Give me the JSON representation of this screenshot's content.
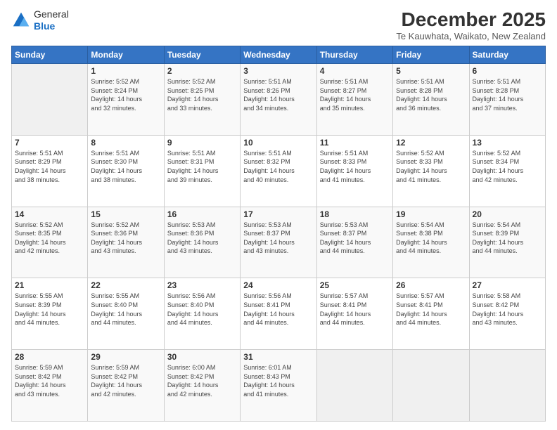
{
  "header": {
    "logo_general": "General",
    "logo_blue": "Blue",
    "month": "December 2025",
    "location": "Te Kauwhata, Waikato, New Zealand"
  },
  "weekdays": [
    "Sunday",
    "Monday",
    "Tuesday",
    "Wednesday",
    "Thursday",
    "Friday",
    "Saturday"
  ],
  "weeks": [
    [
      {
        "day": "",
        "info": ""
      },
      {
        "day": "1",
        "info": "Sunrise: 5:52 AM\nSunset: 8:24 PM\nDaylight: 14 hours\nand 32 minutes."
      },
      {
        "day": "2",
        "info": "Sunrise: 5:52 AM\nSunset: 8:25 PM\nDaylight: 14 hours\nand 33 minutes."
      },
      {
        "day": "3",
        "info": "Sunrise: 5:51 AM\nSunset: 8:26 PM\nDaylight: 14 hours\nand 34 minutes."
      },
      {
        "day": "4",
        "info": "Sunrise: 5:51 AM\nSunset: 8:27 PM\nDaylight: 14 hours\nand 35 minutes."
      },
      {
        "day": "5",
        "info": "Sunrise: 5:51 AM\nSunset: 8:28 PM\nDaylight: 14 hours\nand 36 minutes."
      },
      {
        "day": "6",
        "info": "Sunrise: 5:51 AM\nSunset: 8:28 PM\nDaylight: 14 hours\nand 37 minutes."
      }
    ],
    [
      {
        "day": "7",
        "info": "Sunrise: 5:51 AM\nSunset: 8:29 PM\nDaylight: 14 hours\nand 38 minutes."
      },
      {
        "day": "8",
        "info": "Sunrise: 5:51 AM\nSunset: 8:30 PM\nDaylight: 14 hours\nand 38 minutes."
      },
      {
        "day": "9",
        "info": "Sunrise: 5:51 AM\nSunset: 8:31 PM\nDaylight: 14 hours\nand 39 minutes."
      },
      {
        "day": "10",
        "info": "Sunrise: 5:51 AM\nSunset: 8:32 PM\nDaylight: 14 hours\nand 40 minutes."
      },
      {
        "day": "11",
        "info": "Sunrise: 5:51 AM\nSunset: 8:33 PM\nDaylight: 14 hours\nand 41 minutes."
      },
      {
        "day": "12",
        "info": "Sunrise: 5:52 AM\nSunset: 8:33 PM\nDaylight: 14 hours\nand 41 minutes."
      },
      {
        "day": "13",
        "info": "Sunrise: 5:52 AM\nSunset: 8:34 PM\nDaylight: 14 hours\nand 42 minutes."
      }
    ],
    [
      {
        "day": "14",
        "info": "Sunrise: 5:52 AM\nSunset: 8:35 PM\nDaylight: 14 hours\nand 42 minutes."
      },
      {
        "day": "15",
        "info": "Sunrise: 5:52 AM\nSunset: 8:36 PM\nDaylight: 14 hours\nand 43 minutes."
      },
      {
        "day": "16",
        "info": "Sunrise: 5:53 AM\nSunset: 8:36 PM\nDaylight: 14 hours\nand 43 minutes."
      },
      {
        "day": "17",
        "info": "Sunrise: 5:53 AM\nSunset: 8:37 PM\nDaylight: 14 hours\nand 43 minutes."
      },
      {
        "day": "18",
        "info": "Sunrise: 5:53 AM\nSunset: 8:37 PM\nDaylight: 14 hours\nand 44 minutes."
      },
      {
        "day": "19",
        "info": "Sunrise: 5:54 AM\nSunset: 8:38 PM\nDaylight: 14 hours\nand 44 minutes."
      },
      {
        "day": "20",
        "info": "Sunrise: 5:54 AM\nSunset: 8:39 PM\nDaylight: 14 hours\nand 44 minutes."
      }
    ],
    [
      {
        "day": "21",
        "info": "Sunrise: 5:55 AM\nSunset: 8:39 PM\nDaylight: 14 hours\nand 44 minutes."
      },
      {
        "day": "22",
        "info": "Sunrise: 5:55 AM\nSunset: 8:40 PM\nDaylight: 14 hours\nand 44 minutes."
      },
      {
        "day": "23",
        "info": "Sunrise: 5:56 AM\nSunset: 8:40 PM\nDaylight: 14 hours\nand 44 minutes."
      },
      {
        "day": "24",
        "info": "Sunrise: 5:56 AM\nSunset: 8:41 PM\nDaylight: 14 hours\nand 44 minutes."
      },
      {
        "day": "25",
        "info": "Sunrise: 5:57 AM\nSunset: 8:41 PM\nDaylight: 14 hours\nand 44 minutes."
      },
      {
        "day": "26",
        "info": "Sunrise: 5:57 AM\nSunset: 8:41 PM\nDaylight: 14 hours\nand 44 minutes."
      },
      {
        "day": "27",
        "info": "Sunrise: 5:58 AM\nSunset: 8:42 PM\nDaylight: 14 hours\nand 43 minutes."
      }
    ],
    [
      {
        "day": "28",
        "info": "Sunrise: 5:59 AM\nSunset: 8:42 PM\nDaylight: 14 hours\nand 43 minutes."
      },
      {
        "day": "29",
        "info": "Sunrise: 5:59 AM\nSunset: 8:42 PM\nDaylight: 14 hours\nand 42 minutes."
      },
      {
        "day": "30",
        "info": "Sunrise: 6:00 AM\nSunset: 8:42 PM\nDaylight: 14 hours\nand 42 minutes."
      },
      {
        "day": "31",
        "info": "Sunrise: 6:01 AM\nSunset: 8:43 PM\nDaylight: 14 hours\nand 41 minutes."
      },
      {
        "day": "",
        "info": ""
      },
      {
        "day": "",
        "info": ""
      },
      {
        "day": "",
        "info": ""
      }
    ]
  ]
}
